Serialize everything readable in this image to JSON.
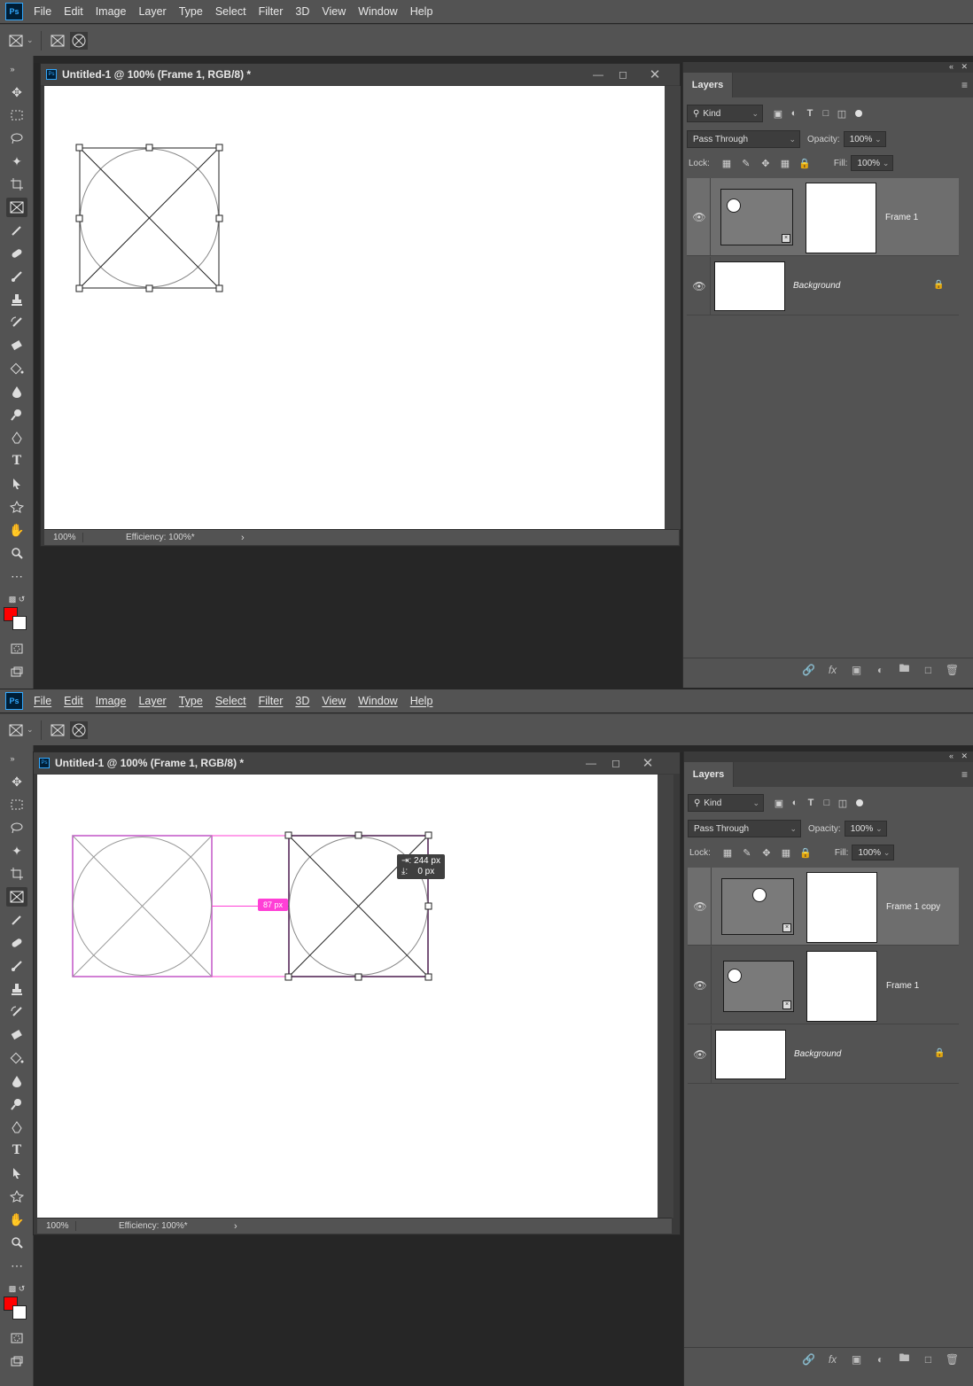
{
  "menu": [
    "File",
    "Edit",
    "Image",
    "Layer",
    "Type",
    "Select",
    "Filter",
    "3D",
    "View",
    "Window",
    "Help"
  ],
  "app_logo": "Ps",
  "top": {
    "doc_title": "Untitled-1 @ 100% (Frame 1, RGB/8) *",
    "status_zoom": "100%",
    "status_efficiency": "Efficiency: 100%*",
    "layers_tab": "Layers",
    "kind_label": "Kind",
    "blend_mode": "Pass Through",
    "opacity_label": "Opacity:",
    "opacity_value": "100%",
    "lock_label": "Lock:",
    "fill_label": "Fill:",
    "fill_value": "100%",
    "layers": [
      {
        "name": "Frame 1",
        "type": "frame",
        "selected": true
      },
      {
        "name": "Background",
        "type": "background",
        "selected": false
      }
    ]
  },
  "bottom": {
    "doc_title": "Untitled-1 @ 100% (Frame 1, RGB/8) *",
    "status_zoom": "100%",
    "status_efficiency": "Efficiency: 100%*",
    "layers_tab": "Layers",
    "kind_label": "Kind",
    "blend_mode": "Pass Through",
    "opacity_label": "Opacity:",
    "opacity_value": "100%",
    "lock_label": "Lock:",
    "fill_label": "Fill:",
    "fill_value": "100%",
    "tooltip_x": "244 px",
    "tooltip_y": "0 px",
    "gap_label": "87 px",
    "layers": [
      {
        "name": "Frame 1 copy",
        "type": "frame",
        "selected": true
      },
      {
        "name": "Frame 1",
        "type": "frame",
        "selected": false
      },
      {
        "name": "Background",
        "type": "background",
        "selected": false
      }
    ]
  },
  "colors": {
    "foreground": "#ff0000",
    "background": "#ffffff",
    "smart_guide": "#ff3fd6",
    "accent": "#31a8ff"
  }
}
